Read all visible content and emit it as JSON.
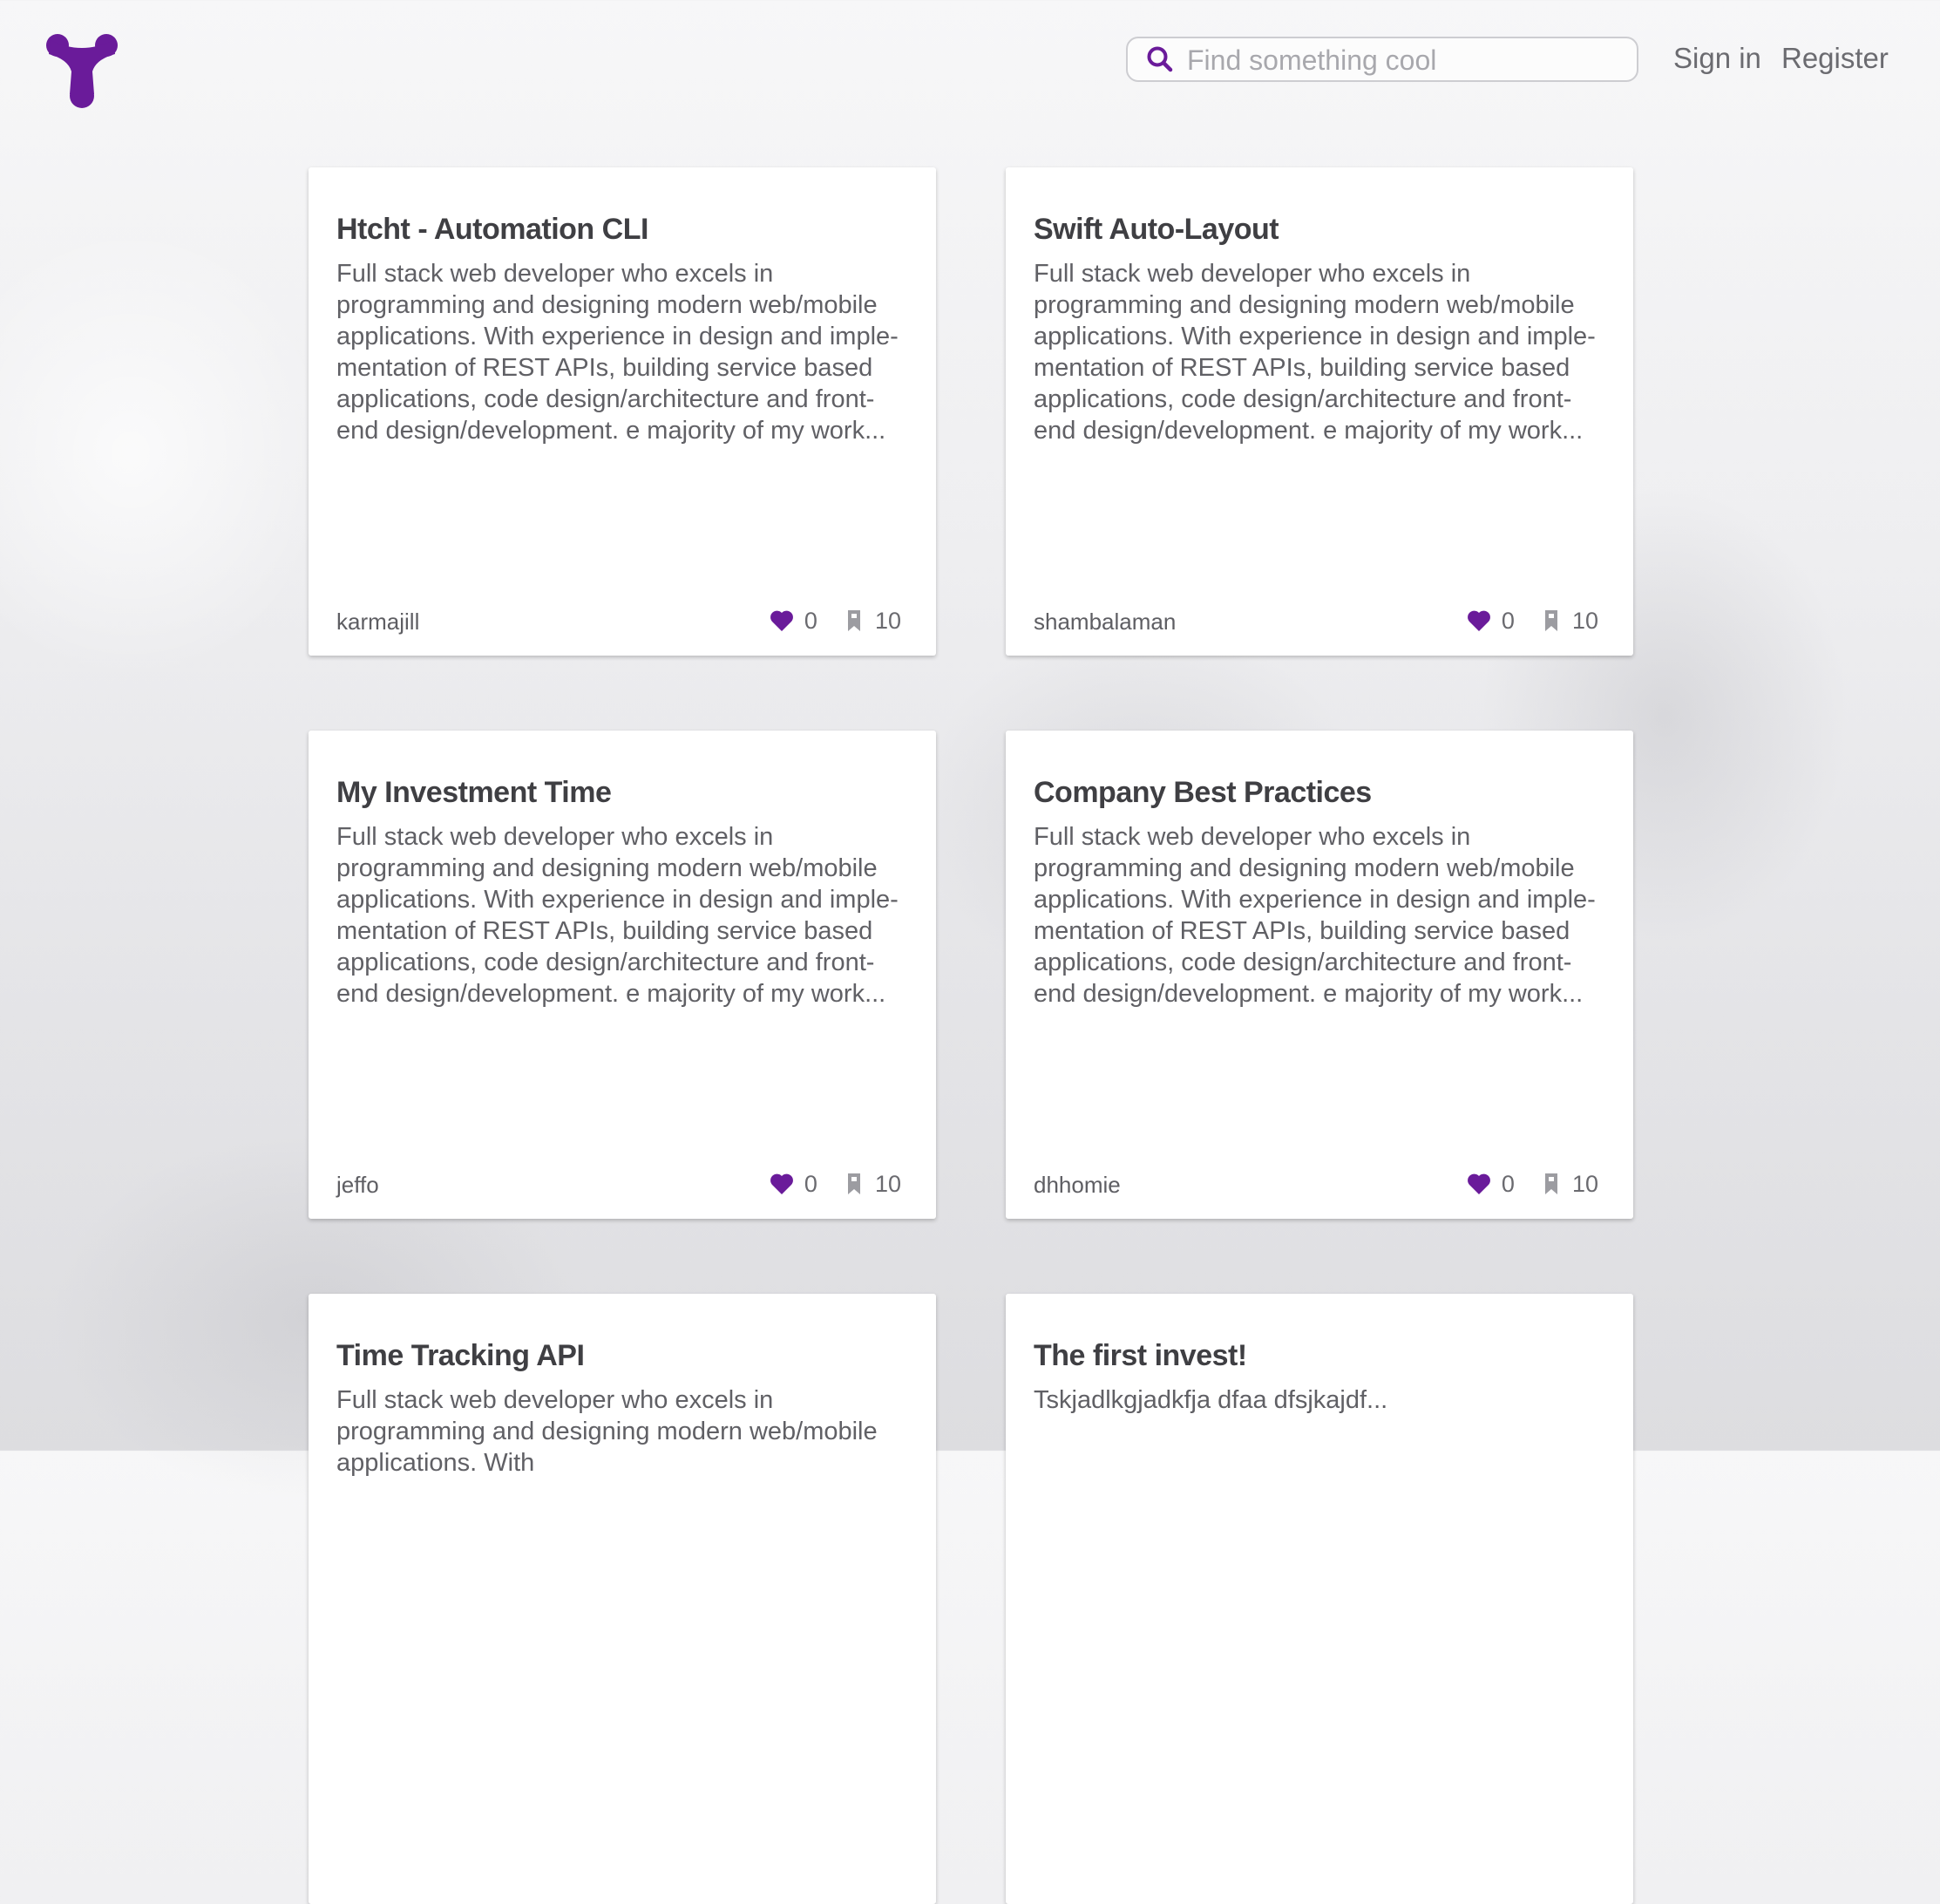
{
  "header": {
    "logo_icon": "app-logo-icon",
    "search": {
      "placeholder": "Find something cool",
      "value": "",
      "icon": "search-icon"
    },
    "nav": {
      "sign_in": "Sign in",
      "register": "Register"
    }
  },
  "colors": {
    "accent": "#6a1b9a",
    "text": "#3f3f43",
    "muted": "#606065"
  },
  "cards": [
    {
      "title": "Htcht - Automation CLI",
      "description": "Full stack web developer who excels in programming and designing modern web/mobile applications. With experience in design and imple- mentation of REST APIs, building service based applications, code design/architecture and front-end design/development. e majority of my work...",
      "author": "karmajill",
      "likes": "0",
      "bookmarks": "10"
    },
    {
      "title": "Swift Auto-Layout",
      "description": "Full stack web developer who excels in programming and designing modern web/mobile applications. With experience in design and imple- mentation of REST APIs, building service based applications, code design/architecture and front-end design/development. e majority of my work...",
      "author": "shambalaman",
      "likes": "0",
      "bookmarks": "10"
    },
    {
      "title": "My Investment Time",
      "description": "Full stack web developer who excels in programming and designing modern web/mobile applications. With experience in design and imple- mentation of REST APIs, building service based applications, code design/architecture and front-end design/development. e majority of my work...",
      "author": "jeffo",
      "likes": "0",
      "bookmarks": "10"
    },
    {
      "title": "Company Best Practices",
      "description": "Full stack web developer who excels in programming and designing modern web/mobile applications. With experience in design and imple- mentation of REST APIs, building service based applications, code design/architecture and front-end design/development. e majority of my work...",
      "author": "dhhomie",
      "likes": "0",
      "bookmarks": "10"
    },
    {
      "title": "Time Tracking API",
      "description": "Full stack web developer who excels in programming and designing modern web/mobile applications. With"
    },
    {
      "title": "The first invest!",
      "description": "Tskjadlkgjadkfja dfaa dfsjkajdf..."
    }
  ]
}
